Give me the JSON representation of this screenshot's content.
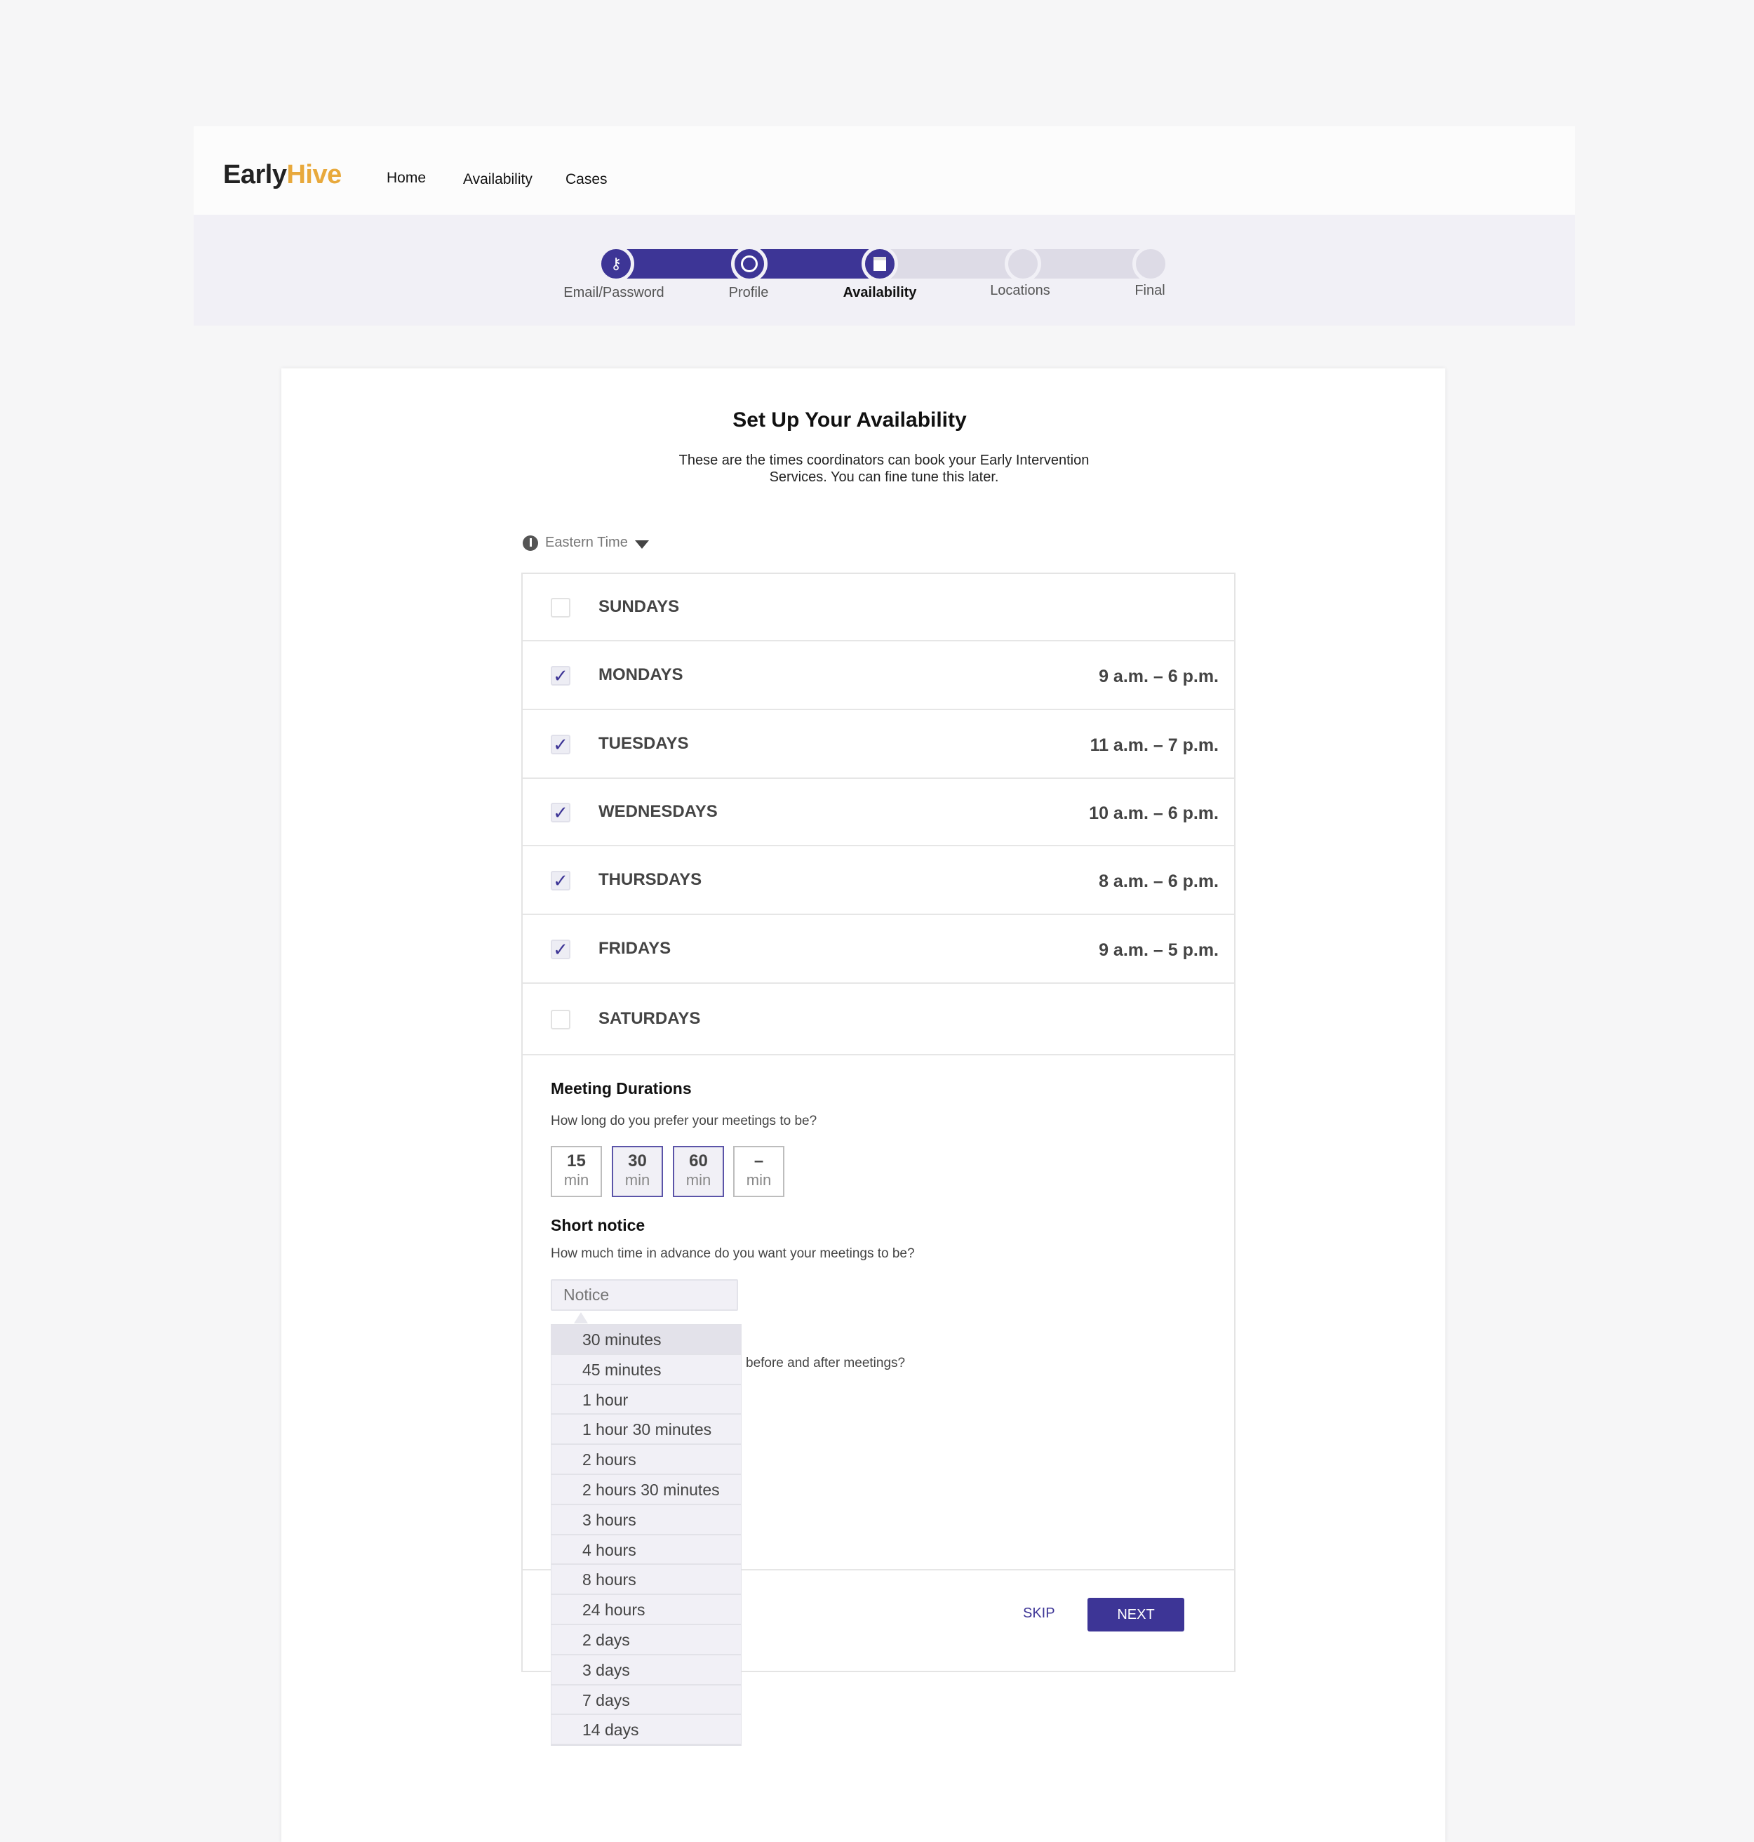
{
  "brand": {
    "part1": "Early",
    "part2": "Hive",
    "accent": "#e8a93c"
  },
  "nav": [
    "Home",
    "Availability",
    "Cases"
  ],
  "stepper": {
    "steps": [
      {
        "label": "Email/Password",
        "icon": "key-icon",
        "done": true
      },
      {
        "label": "Profile",
        "icon": "face-icon",
        "done": true
      },
      {
        "label": "Availability",
        "icon": "calendar-icon",
        "done": true,
        "current": true
      },
      {
        "label": "Locations",
        "icon": "",
        "done": false
      },
      {
        "label": "Final",
        "icon": "",
        "done": false
      }
    ],
    "color": "#3d3596"
  },
  "page": {
    "title": "Set Up Your Availability",
    "subtitle": "These are the times coordinators can book your Early Intervention Services. You can fine tune this later."
  },
  "timezone": "Eastern Time",
  "days": [
    {
      "name": "SUNDAYS",
      "checked": false,
      "time": ""
    },
    {
      "name": "MONDAYS",
      "checked": true,
      "time": "9 a.m. – 6 p.m."
    },
    {
      "name": "TUESDAYS",
      "checked": true,
      "time": "11 a.m. – 7 p.m."
    },
    {
      "name": "WEDNESDAYS",
      "checked": true,
      "time": "10 a.m. – 6 p.m."
    },
    {
      "name": "THURSDAYS",
      "checked": true,
      "time": "8 a.m. – 6 p.m."
    },
    {
      "name": "FRIDAYS",
      "checked": true,
      "time": "9 a.m. – 5 p.m."
    },
    {
      "name": "SATURDAYS",
      "checked": false,
      "time": ""
    }
  ],
  "durations": {
    "title": "Meeting Durations",
    "question": "How long do you prefer your meetings to be?",
    "unit": "min",
    "options": [
      {
        "value": "15",
        "selected": false
      },
      {
        "value": "30",
        "selected": true
      },
      {
        "value": "60",
        "selected": true
      },
      {
        "value": "–",
        "selected": false
      }
    ]
  },
  "notice": {
    "title": "Short notice",
    "question": "How much time in advance do you want your meetings to be?",
    "placeholder": "Notice",
    "options": [
      "30 minutes",
      "45 minutes",
      "1 hour",
      "1 hour 30 minutes",
      "2 hours",
      "2 hours 30 minutes",
      "3 hours",
      "4 hours",
      "8 hours",
      "24 hours",
      "2 days",
      "3 days",
      "7 days",
      "14 days"
    ],
    "highlighted": "30 minutes"
  },
  "buffer_question_fragment": "before and after meetings?",
  "actions": {
    "skip": "SKIP",
    "next": "NEXT"
  }
}
